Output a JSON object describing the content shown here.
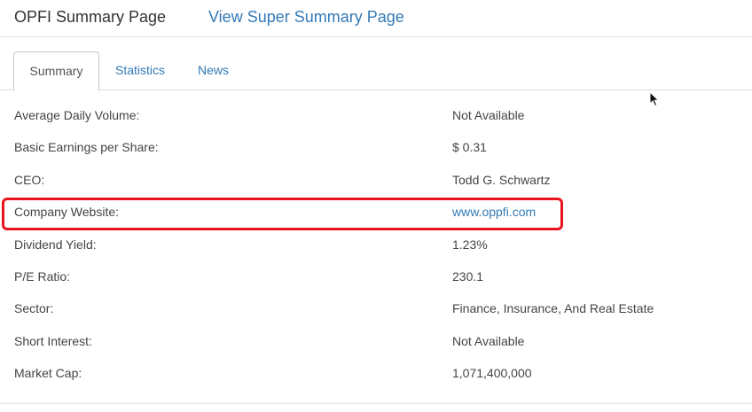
{
  "header": {
    "title": "OPFI Summary Page",
    "super_summary_link": "View Super Summary Page"
  },
  "tabs": [
    {
      "label": "Summary",
      "active": true
    },
    {
      "label": "Statistics",
      "active": false
    },
    {
      "label": "News",
      "active": false
    }
  ],
  "summary": {
    "rows": [
      {
        "label": "Average Daily Volume:",
        "value": "Not Available"
      },
      {
        "label": "Basic Earnings per Share:",
        "value": "$ 0.31"
      },
      {
        "label": "CEO:",
        "value": "Todd G. Schwartz"
      },
      {
        "label": "Company Website:",
        "value": "www.oppfi.com",
        "is_link": true,
        "highlighted": true
      },
      {
        "label": "Dividend Yield:",
        "value": "1.23%"
      },
      {
        "label": "P/E Ratio:",
        "value": "230.1"
      },
      {
        "label": "Sector:",
        "value": "Finance, Insurance, And Real Estate"
      },
      {
        "label": "Short Interest:",
        "value": "Not Available"
      },
      {
        "label": "Market Cap:",
        "value": "1,071,400,000"
      }
    ]
  },
  "colors": {
    "link": "#337ab7",
    "highlight": "#e8141b",
    "text": "#444444"
  },
  "icons": {
    "cursor": "mouse-pointer-icon"
  }
}
